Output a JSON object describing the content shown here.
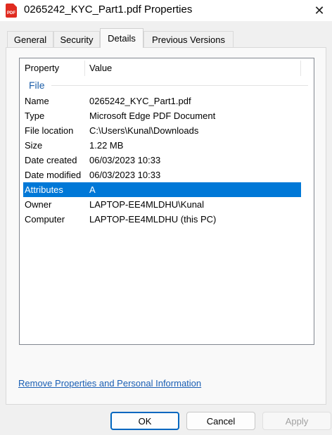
{
  "window": {
    "title": "0265242_KYC_Part1.pdf Properties",
    "icon_text": "PDF",
    "close_glyph": "✕"
  },
  "tabs": [
    {
      "label": "General"
    },
    {
      "label": "Security"
    },
    {
      "label": "Details"
    },
    {
      "label": "Previous Versions"
    }
  ],
  "active_tab": "Details",
  "details": {
    "columns": {
      "property": "Property",
      "value": "Value"
    },
    "group": "File",
    "rows": [
      {
        "property": "Name",
        "value": "0265242_KYC_Part1.pdf"
      },
      {
        "property": "Type",
        "value": "Microsoft Edge PDF Document"
      },
      {
        "property": "File location",
        "value": "C:\\Users\\Kunal\\Downloads"
      },
      {
        "property": "Size",
        "value": "1.22 MB"
      },
      {
        "property": "Date created",
        "value": "06/03/2023 10:33"
      },
      {
        "property": "Date modified",
        "value": "06/03/2023 10:33"
      },
      {
        "property": "Attributes",
        "value": "A"
      },
      {
        "property": "Owner",
        "value": "LAPTOP-EE4MLDHU\\Kunal"
      },
      {
        "property": "Computer",
        "value": "LAPTOP-EE4MLDHU (this PC)"
      }
    ],
    "selected_row": "Attributes"
  },
  "link": {
    "text": "Remove Properties and Personal Information"
  },
  "buttons": {
    "ok": "OK",
    "cancel": "Cancel",
    "apply": "Apply"
  },
  "colors": {
    "selection": "#0078d7",
    "link": "#1a5fb4",
    "group": "#1c5ea8"
  }
}
